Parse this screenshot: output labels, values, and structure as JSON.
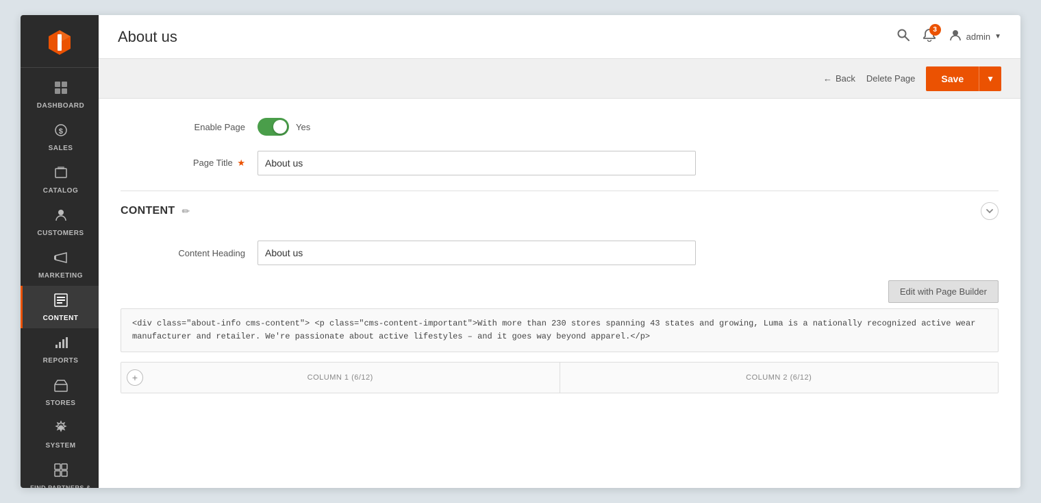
{
  "sidebar": {
    "items": [
      {
        "id": "dashboard",
        "label": "DASHBOARD",
        "icon": "⊞"
      },
      {
        "id": "sales",
        "label": "SALES",
        "icon": "$"
      },
      {
        "id": "catalog",
        "label": "CATALOG",
        "icon": "📦"
      },
      {
        "id": "customers",
        "label": "CUSTOMERS",
        "icon": "👤"
      },
      {
        "id": "marketing",
        "label": "MARKETING",
        "icon": "📢"
      },
      {
        "id": "content",
        "label": "CONTENT",
        "icon": "▦",
        "active": true
      },
      {
        "id": "reports",
        "label": "REPORTS",
        "icon": "📊"
      },
      {
        "id": "stores",
        "label": "STORES",
        "icon": "🏪"
      },
      {
        "id": "system",
        "label": "SYSTEM",
        "icon": "⚙"
      },
      {
        "id": "find-partners",
        "label": "FIND PARTNERS & EXTENSIONS",
        "icon": "🔲"
      }
    ]
  },
  "header": {
    "page_title": "About us",
    "notification_count": "3",
    "user_name": "admin",
    "search_placeholder": "Search..."
  },
  "toolbar": {
    "back_label": "Back",
    "delete_label": "Delete Page",
    "save_label": "Save"
  },
  "form": {
    "enable_page_label": "Enable Page",
    "enable_page_value": "Yes",
    "page_title_label": "Page Title",
    "page_title_value": "About us"
  },
  "content_section": {
    "title": "Content",
    "content_heading_label": "Content Heading",
    "content_heading_value": "About us",
    "page_builder_btn": "Edit with Page Builder",
    "code_content": "<div class=\"about-info cms-content\">\n        <p class=\"cms-content-important\">With more than 230 stores spanning 43 states and growing, Luma is a nationally recognized active wear manufacturer and retailer. We're passionate about active lifestyles\n        – and it goes way beyond apparel.</p>",
    "column1_label": "COLUMN 1 (6/12)",
    "column2_label": "COLUMN 2 (6/12)"
  }
}
